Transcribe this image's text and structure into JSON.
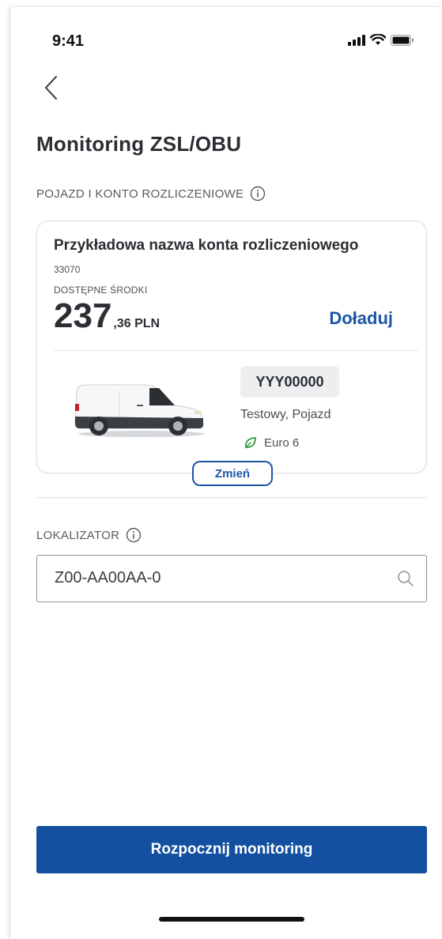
{
  "status_bar": {
    "time": "9:41"
  },
  "page": {
    "title": "Monitoring ZSL/OBU"
  },
  "vehicle_section": {
    "label": "POJAZD I KONTO ROZLICZENIOWE",
    "account": {
      "name": "Przykładowa nazwa konta rozliczeniowego",
      "number": "33070",
      "funds_label": "DOSTĘPNE ŚRODKI",
      "amount_int": "237",
      "amount_rest": ",36 PLN",
      "topup_label": "Doładuj"
    },
    "vehicle": {
      "plate": "YYY00000",
      "name": "Testowy, Pojazd",
      "emission": "Euro 6"
    },
    "change_label": "Zmień"
  },
  "locator_section": {
    "label": "LOKALIZATOR",
    "value": "Z00-AA00AA-0"
  },
  "actions": {
    "start_label": "Rozpocznij monitoring"
  },
  "colors": {
    "accent": "#1d55a5",
    "primary_button": "#1450a0",
    "eco_leaf": "#2e9b3a"
  },
  "icons": [
    "signal-icon",
    "wifi-icon",
    "battery-icon",
    "back-chevron-icon",
    "info-icon",
    "van-icon",
    "leaf-icon",
    "search-icon"
  ]
}
